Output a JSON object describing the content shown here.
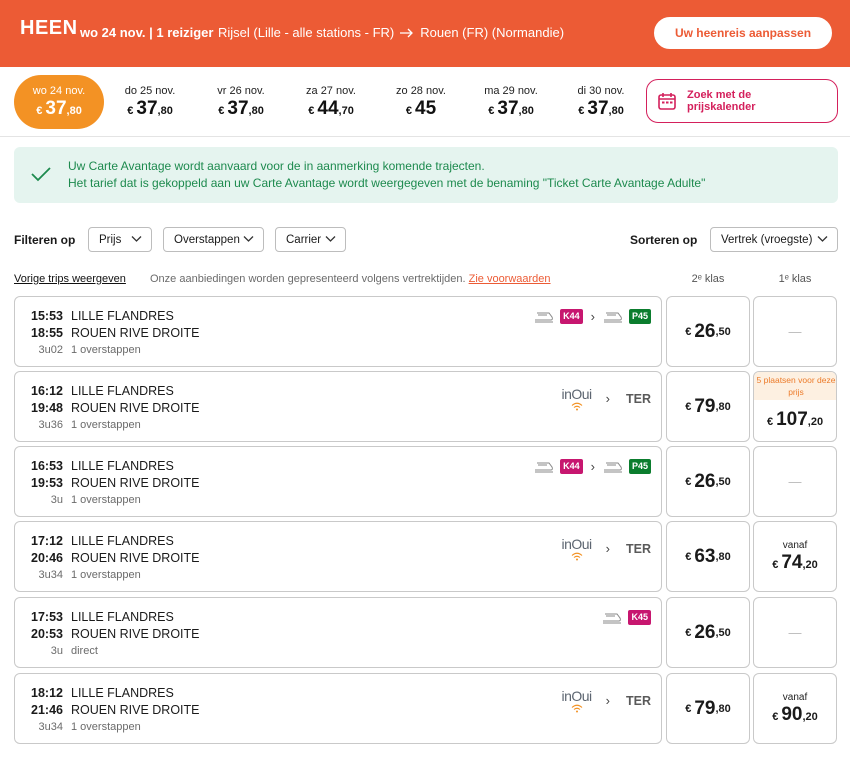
{
  "header": {
    "heen": "HEEN",
    "date_travelers": "wo 24 nov. | 1 reiziger",
    "origin": "Rijsel (Lille - alle stations - FR)",
    "destination": "Rouen (FR) (Normandie)",
    "adjust_button": "Uw heenreis aanpassen",
    "brand_color": "#ec5b35"
  },
  "date_strip": {
    "items": [
      {
        "label": "wo 24 nov.",
        "euro": "€",
        "int": "37",
        "dec": ",80",
        "active": true
      },
      {
        "label": "do 25 nov.",
        "euro": "€",
        "int": "37",
        "dec": ",80"
      },
      {
        "label": "vr 26 nov.",
        "euro": "€",
        "int": "37",
        "dec": ",80"
      },
      {
        "label": "za 27 nov.",
        "euro": "€",
        "int": "44",
        "dec": ",70"
      },
      {
        "label": "zo 28 nov.",
        "euro": "€",
        "int": "45",
        "dec": ""
      },
      {
        "label": "ma 29 nov.",
        "euro": "€",
        "int": "37",
        "dec": ",80"
      },
      {
        "label": "di 30 nov.",
        "euro": "€",
        "int": "37",
        "dec": ",80"
      }
    ],
    "calendar_button": "Zoek met de prijskalender"
  },
  "banner": {
    "line1": "Uw Carte Avantage wordt aanvaard voor de in aanmerking komende trajecten.",
    "line2": "Het tarief dat is gekoppeld aan uw Carte Avantage wordt weergegeven met de benaming \"Ticket Carte Avantage Adulte\""
  },
  "filters": {
    "label": "Filteren op",
    "price": "Prijs",
    "transfers": "Overstappen",
    "carrier": "Carrier",
    "sort_label": "Sorteren op",
    "sort_value": "Vertrek (vroegste)"
  },
  "subheader": {
    "previous_trips": "Vorige trips weergeven",
    "offers_text": "Onze aanbiedingen worden gepresenteerd volgens vertrektijden.",
    "conditions_link": "Zie voorwaarden",
    "class2": "2ᵉ klas",
    "class1": "1ᵉ klas"
  },
  "trips": [
    {
      "dep": "15:53",
      "arr": "18:55",
      "from": "LILLE FLANDRES",
      "to": "ROUEN RIVE DROITE",
      "duration": "3u02",
      "changes": "1 overstappen",
      "carriers": "k44p45",
      "b1": "K44",
      "b2": "P45",
      "p2": {
        "euro": "€",
        "int": "26",
        "dec": ",50"
      },
      "p1": {
        "dash": "—"
      }
    },
    {
      "dep": "16:12",
      "arr": "19:48",
      "from": "LILLE FLANDRES",
      "to": "ROUEN RIVE DROITE",
      "duration": "3u36",
      "changes": "1 overstappen",
      "carriers": "inoui",
      "inoui": "inOui",
      "ter": "TER",
      "p2": {
        "euro": "€",
        "int": "79",
        "dec": ",80"
      },
      "p1": {
        "seats": "5 plaatsen voor deze prijs",
        "euro": "€",
        "int": "107",
        "dec": ",20"
      }
    },
    {
      "dep": "16:53",
      "arr": "19:53",
      "from": "LILLE FLANDRES",
      "to": "ROUEN RIVE DROITE",
      "duration": "3u",
      "changes": "1 overstappen",
      "carriers": "k44p45",
      "b1": "K44",
      "b2": "P45",
      "p2": {
        "euro": "€",
        "int": "26",
        "dec": ",50"
      },
      "p1": {
        "dash": "—"
      }
    },
    {
      "dep": "17:12",
      "arr": "20:46",
      "from": "LILLE FLANDRES",
      "to": "ROUEN RIVE DROITE",
      "duration": "3u34",
      "changes": "1 overstappen",
      "carriers": "inoui",
      "inoui": "inOui",
      "ter": "TER",
      "p2": {
        "euro": "€",
        "int": "63",
        "dec": ",80"
      },
      "p1": {
        "vanaf": "vanaf",
        "euro": "€",
        "int": "74",
        "dec": ",20"
      }
    },
    {
      "dep": "17:53",
      "arr": "20:53",
      "from": "LILLE FLANDRES",
      "to": "ROUEN RIVE DROITE",
      "duration": "3u",
      "changes": "direct",
      "carriers": "k45",
      "b1": "K45",
      "p2": {
        "euro": "€",
        "int": "26",
        "dec": ",50"
      },
      "p1": {
        "dash": "—"
      }
    },
    {
      "dep": "18:12",
      "arr": "21:46",
      "from": "LILLE FLANDRES",
      "to": "ROUEN RIVE DROITE",
      "duration": "3u34",
      "changes": "1 overstappen",
      "carriers": "inoui",
      "inoui": "inOui",
      "ter": "TER",
      "p2": {
        "euro": "€",
        "int": "79",
        "dec": ",80"
      },
      "p1": {
        "vanaf": "vanaf",
        "euro": "€",
        "int": "90",
        "dec": ",20"
      }
    }
  ]
}
